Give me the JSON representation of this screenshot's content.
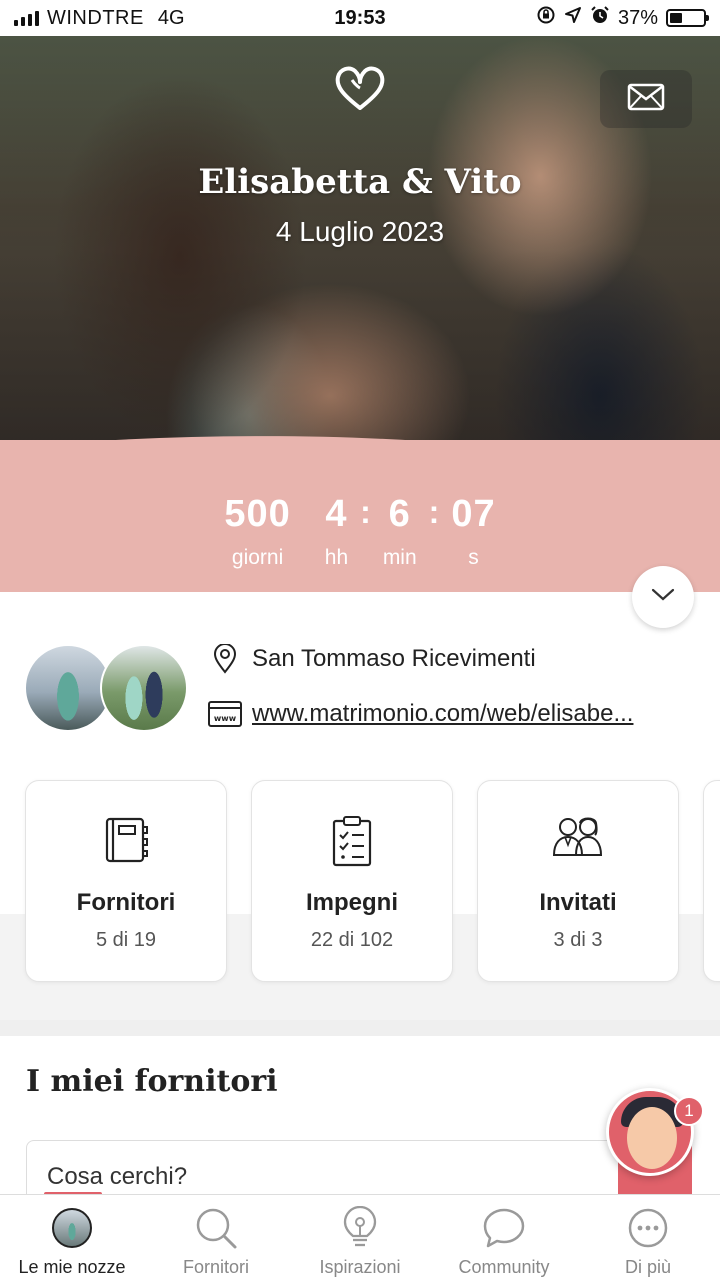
{
  "status_bar": {
    "carrier": "WINDTRE",
    "network": "4G",
    "time": "19:53",
    "battery_percent": "37%",
    "battery_level": 0.37
  },
  "hero": {
    "couple_name": "Elisabetta & Vito",
    "wedding_date": "4 Luglio 2023",
    "icons": [
      "heart-logo-icon",
      "mail-icon"
    ]
  },
  "countdown": {
    "units": [
      {
        "value": "500",
        "label": "giorni"
      },
      {
        "value": "4",
        "label": "hh"
      },
      {
        "value": "6",
        "label": "min"
      },
      {
        "value": "07",
        "label": "s"
      }
    ],
    "separator": ":",
    "band_color": "#e8b4ae"
  },
  "info": {
    "venue": "San Tommaso Ricevimenti",
    "website": "www.matrimonio.com/web/elisabe..."
  },
  "cards": [
    {
      "title": "Fornitori",
      "count": "5 di 19",
      "icon": "notebook-icon"
    },
    {
      "title": "Impegni",
      "count": "22 di 102",
      "icon": "checklist-icon"
    },
    {
      "title": "Invitati",
      "count": "3 di 3",
      "icon": "guests-icon"
    }
  ],
  "suppliers": {
    "title": "I miei fornitori",
    "search_placeholder": "Cosa cerchi?"
  },
  "assistant": {
    "badge_count": "1"
  },
  "bottom_nav": [
    {
      "label": "Le mie nozze",
      "icon": "avatar-icon",
      "active": true
    },
    {
      "label": "Fornitori",
      "icon": "search-icon",
      "active": false
    },
    {
      "label": "Ispirazioni",
      "icon": "lightbulb-icon",
      "active": false
    },
    {
      "label": "Community",
      "icon": "chat-bubble-icon",
      "active": false
    },
    {
      "label": "Di più",
      "icon": "more-icon",
      "active": false
    }
  ],
  "colors": {
    "accent": "#e0616a",
    "countdown_band": "#e8b4ae"
  }
}
